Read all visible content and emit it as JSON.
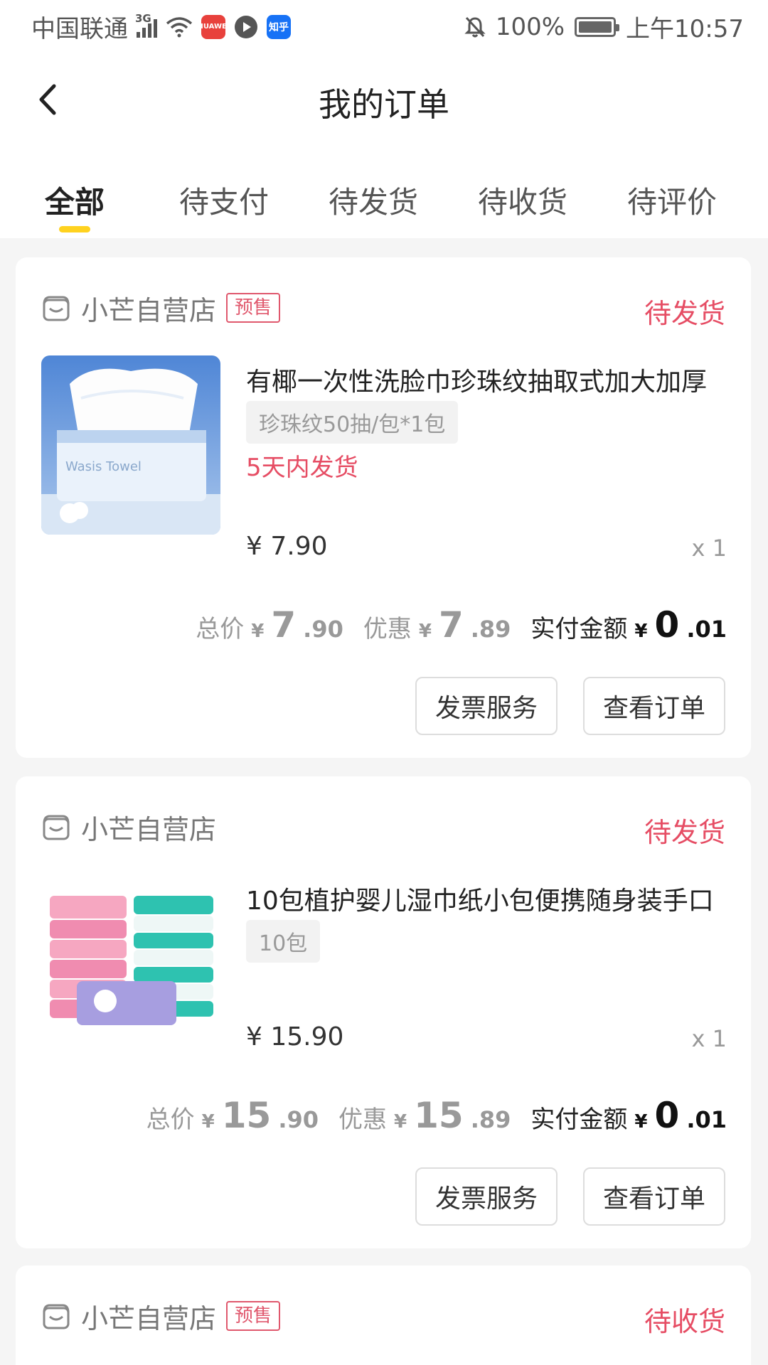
{
  "status_bar": {
    "carrier": "中国联通",
    "network": "3G",
    "app_badges": [
      "HUAWEI",
      "知乎"
    ],
    "battery": "100%",
    "time": "上午10:57"
  },
  "header": {
    "title": "我的订单"
  },
  "tabs": [
    {
      "label": "全部",
      "active": true
    },
    {
      "label": "待支付",
      "active": false
    },
    {
      "label": "待发货",
      "active": false
    },
    {
      "label": "待收货",
      "active": false
    },
    {
      "label": "待评价",
      "active": false
    }
  ],
  "orders": [
    {
      "shop": "小芒自营店",
      "tag": "预售",
      "status": "待发货",
      "product": {
        "name": "有椰一次性洗脸巾珍珠纹抽取式加大加厚",
        "spec": "珍珠纹50抽/包*1包",
        "ship_note": "5天内发货",
        "price": "¥ 7.90",
        "qty": "x 1"
      },
      "totals": {
        "total_label": "总价",
        "currency": "¥",
        "total_int": "7",
        "total_dec": ".90",
        "discount_label": "优惠",
        "discount_int": "7",
        "discount_dec": ".89",
        "paid_label": "实付金额",
        "paid_int": "0",
        "paid_dec": ".01"
      },
      "buttons": {
        "invoice": "发票服务",
        "view": "查看订单"
      }
    },
    {
      "shop": "小芒自营店",
      "status": "待发货",
      "product": {
        "name": "10包植护婴儿湿巾纸小包便携随身装手口",
        "spec": "10包",
        "price": "¥ 15.90",
        "qty": "x 1"
      },
      "totals": {
        "total_label": "总价",
        "currency": "¥",
        "total_int": "15",
        "total_dec": ".90",
        "discount_label": "优惠",
        "discount_int": "15",
        "discount_dec": ".89",
        "paid_label": "实付金额",
        "paid_int": "0",
        "paid_dec": ".01"
      },
      "buttons": {
        "invoice": "发票服务",
        "view": "查看订单"
      }
    },
    {
      "shop": "小芒自营店",
      "tag": "预售",
      "status": "待收货"
    }
  ],
  "colors": {
    "accent_yellow": "#ffd21f",
    "status_red": "#e64d64",
    "muted_gray": "#999999"
  }
}
